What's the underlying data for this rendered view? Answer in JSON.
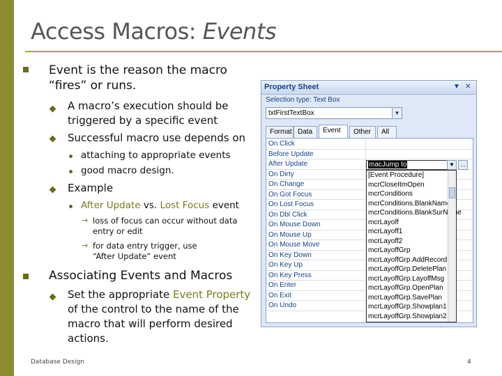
{
  "slide": {
    "title_main": "Access Macros:",
    "title_em": "Events",
    "footer_left": "Database Design",
    "page_number": "4"
  },
  "bullets": {
    "b1": "Event is the reason the macro “fires” or runs.",
    "b1_1": "A macro’s execution should be triggered by a specific event",
    "b1_2": "Successful macro use depends on",
    "b1_2_1": "attaching to appropriate events",
    "b1_2_2": "good macro design.",
    "b1_3": "Example",
    "b1_3_1_a": "After Update",
    "b1_3_1_b": " vs. ",
    "b1_3_1_c": "Lost Focus",
    "b1_3_1_d": " event",
    "b1_3_1_1": "loss of focus can occur without data entry or edit",
    "b1_3_1_2": "for data entry trigger, use “After Update” event",
    "b2": "Associating Events and Macros",
    "b2_1_a": "Set the appropriate ",
    "b2_1_b": "Event Property",
    "b2_1_c": " of the control to the name of the macro that will perform desired actions."
  },
  "property_sheet": {
    "title": "Property Sheet",
    "selection_label": "Selection type:  Text Box",
    "selection_value": "txtFirstTextBox",
    "tabs": [
      "Format",
      "Data",
      "Event",
      "Other",
      "All"
    ],
    "active_tab": "Event",
    "rows": [
      "On Click",
      "Before Update",
      "After Update",
      "On Dirty",
      "On Change",
      "On Got Focus",
      "On Lost Focus",
      "On Dbl Click",
      "On Mouse Down",
      "On Mouse Up",
      "On Mouse Move",
      "On Key Down",
      "On Key Up",
      "On Key Press",
      "On Enter",
      "On Exit",
      "On Undo"
    ],
    "combo_value": "macJump to",
    "list_items": [
      "[Event Procedure]",
      "mcrCloseItmOpen",
      "mcrConditions",
      "mcrConditions.BlankName",
      "mcrConditions.BlankSurName",
      "mcrLayoff",
      "mcrLayoff1",
      "mcrLayoff2",
      "mcrLayoffGrp",
      "mcrLayoffGrp.AddRecord",
      "mcrLayoffGrp.DeletePlan",
      "mcrLayoffGrp.LayoffMsg",
      "mcrLayoffGrp.OpenPlan",
      "mcrLayoffGrp.SavePlan",
      "mcrLayoffGrp.Showplan1",
      "mcrLayoffGrp.Showplan2"
    ]
  },
  "colors": {
    "accent": "#8c8c2e",
    "bullet": "#6b6b1e",
    "label_blue": "#15428b"
  }
}
